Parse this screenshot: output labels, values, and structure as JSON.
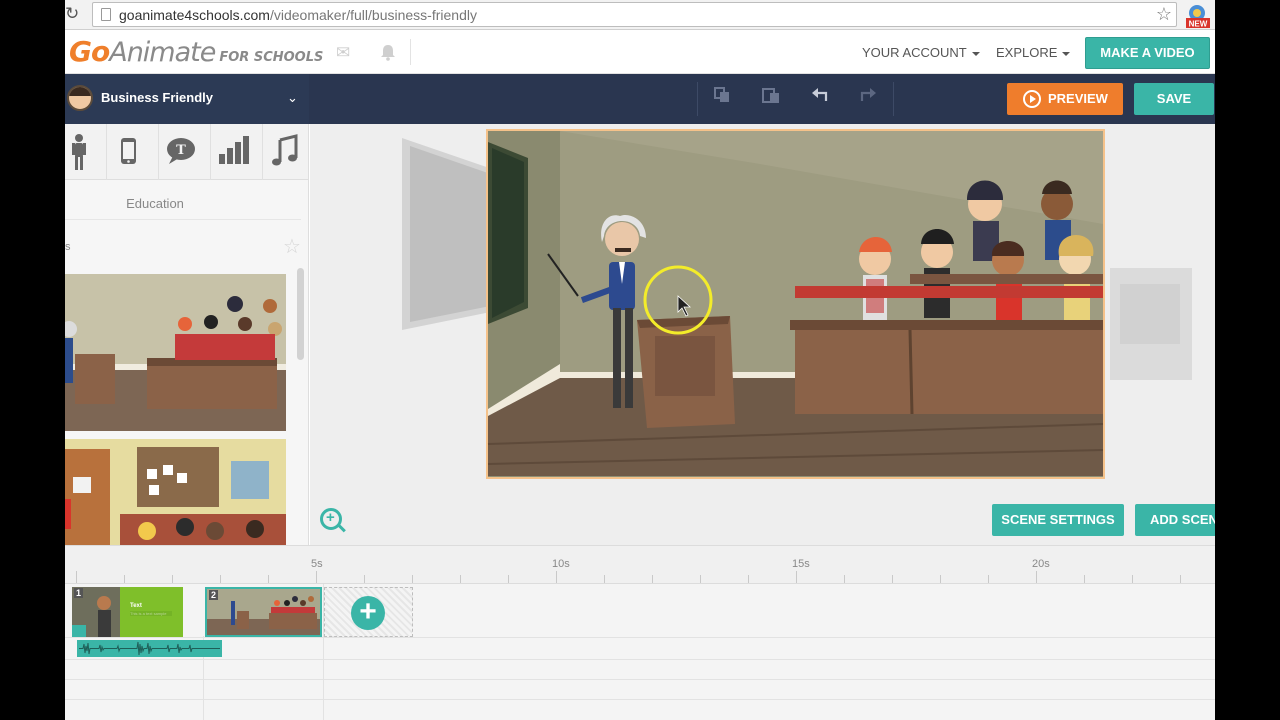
{
  "browser": {
    "url_host": "goanimate4schools.com",
    "url_path": "/videomaker/full/business-friendly",
    "ext_badge": "NEW"
  },
  "header": {
    "logo_go": "Go",
    "logo_animate": "Animate",
    "logo_for_schools": "FOR SCHOOLS",
    "your_account": "YOUR ACCOUNT",
    "explore": "EXPLORE",
    "make_video": "MAKE A VIDEO"
  },
  "toolbar": {
    "theme_name": "Business Friendly",
    "preview_label": "PREVIEW",
    "save_label": "SAVE"
  },
  "left_panel": {
    "category": "Education",
    "cut_text": "s"
  },
  "stage": {
    "scene_settings": "SCENE SETTINGS",
    "add_scene": "ADD SCENE"
  },
  "timeline": {
    "ruler_labels": [
      "5s",
      "10s",
      "15s",
      "20s"
    ],
    "scenes": [
      {
        "num": "1",
        "title": "Text",
        "subtitle": "This is a text sample"
      },
      {
        "num": "2"
      }
    ]
  },
  "colors": {
    "teal": "#3ab5a7",
    "orange": "#ef7d2c",
    "toolbar": "#2c3a55"
  }
}
